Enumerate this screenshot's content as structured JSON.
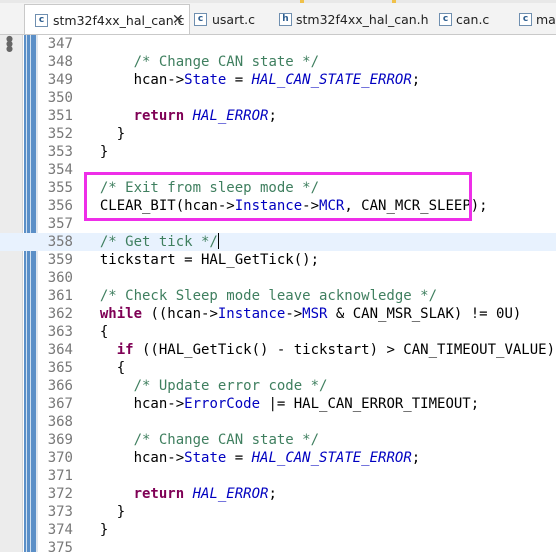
{
  "tabs": [
    {
      "label": "stm32f4xx_hal_can.c",
      "icon": "c-file-icon",
      "icon_letter": "c",
      "active": true,
      "close": "✕"
    },
    {
      "label": "usart.c",
      "icon": "c-file-icon",
      "icon_letter": "c",
      "active": false
    },
    {
      "label": "stm32f4xx_hal_can.h",
      "icon": "h-file-icon",
      "icon_letter": "h",
      "active": false
    },
    {
      "label": "can.c",
      "icon": "c-file-icon",
      "icon_letter": "c",
      "active": false
    },
    {
      "label": "main",
      "icon": "c-file-icon",
      "icon_letter": "c",
      "active": false
    }
  ],
  "editor": {
    "current_line": 358,
    "highlighted_lines": [
      355,
      356
    ],
    "highlight_color": "#ee2ee8",
    "lines": [
      {
        "n": "347",
        "segs": []
      },
      {
        "n": "348",
        "segs": [
          {
            "t": "      "
          },
          {
            "t": "/* Change CAN state */",
            "s": "c"
          }
        ]
      },
      {
        "n": "349",
        "segs": [
          {
            "t": "      hcan->"
          },
          {
            "t": "State",
            "s": "f"
          },
          {
            "t": " = "
          },
          {
            "t": "HAL_CAN_STATE_ERROR",
            "s": "i"
          },
          {
            "t": ";"
          }
        ]
      },
      {
        "n": "350",
        "segs": []
      },
      {
        "n": "351",
        "segs": [
          {
            "t": "      "
          },
          {
            "t": "return",
            "s": "k"
          },
          {
            "t": " "
          },
          {
            "t": "HAL_ERROR",
            "s": "i"
          },
          {
            "t": ";"
          }
        ]
      },
      {
        "n": "352",
        "segs": [
          {
            "t": "    }"
          }
        ]
      },
      {
        "n": "353",
        "segs": [
          {
            "t": "  }"
          }
        ]
      },
      {
        "n": "354",
        "segs": []
      },
      {
        "n": "355",
        "segs": [
          {
            "t": "  "
          },
          {
            "t": "/* Exit from sleep mode */",
            "s": "c"
          }
        ]
      },
      {
        "n": "356",
        "segs": [
          {
            "t": "  CLEAR_BIT(hcan->"
          },
          {
            "t": "Instance",
            "s": "f"
          },
          {
            "t": "->"
          },
          {
            "t": "MCR",
            "s": "f"
          },
          {
            "t": ", CAN_MCR_SLEEP);"
          }
        ]
      },
      {
        "n": "357",
        "segs": []
      },
      {
        "n": "358",
        "segs": [
          {
            "t": "  "
          },
          {
            "t": "/* Get tick */",
            "s": "c"
          }
        ]
      },
      {
        "n": "359",
        "segs": [
          {
            "t": "  tickstart = HAL_GetTick();"
          }
        ]
      },
      {
        "n": "360",
        "segs": []
      },
      {
        "n": "361",
        "segs": [
          {
            "t": "  "
          },
          {
            "t": "/* Check Sleep mode leave acknowledge */",
            "s": "c"
          }
        ]
      },
      {
        "n": "362",
        "segs": [
          {
            "t": "  "
          },
          {
            "t": "while",
            "s": "k"
          },
          {
            "t": " ((hcan->"
          },
          {
            "t": "Instance",
            "s": "f"
          },
          {
            "t": "->"
          },
          {
            "t": "MSR",
            "s": "f"
          },
          {
            "t": " & CAN_MSR_SLAK) != 0U)"
          }
        ]
      },
      {
        "n": "363",
        "segs": [
          {
            "t": "  {"
          }
        ]
      },
      {
        "n": "364",
        "segs": [
          {
            "t": "    "
          },
          {
            "t": "if",
            "s": "k"
          },
          {
            "t": " ((HAL_GetTick() - tickstart) > CAN_TIMEOUT_VALUE)"
          }
        ]
      },
      {
        "n": "365",
        "segs": [
          {
            "t": "    {"
          }
        ]
      },
      {
        "n": "366",
        "segs": [
          {
            "t": "      "
          },
          {
            "t": "/* Update error code */",
            "s": "c"
          }
        ]
      },
      {
        "n": "367",
        "segs": [
          {
            "t": "      hcan->"
          },
          {
            "t": "ErrorCode",
            "s": "f"
          },
          {
            "t": " |= HAL_CAN_ERROR_TIMEOUT;"
          }
        ]
      },
      {
        "n": "368",
        "segs": []
      },
      {
        "n": "369",
        "segs": [
          {
            "t": "      "
          },
          {
            "t": "/* Change CAN state */",
            "s": "c"
          }
        ]
      },
      {
        "n": "370",
        "segs": [
          {
            "t": "      hcan->"
          },
          {
            "t": "State",
            "s": "f"
          },
          {
            "t": " = "
          },
          {
            "t": "HAL_CAN_STATE_ERROR",
            "s": "i"
          },
          {
            "t": ";"
          }
        ]
      },
      {
        "n": "371",
        "segs": []
      },
      {
        "n": "372",
        "segs": [
          {
            "t": "      "
          },
          {
            "t": "return",
            "s": "k"
          },
          {
            "t": " "
          },
          {
            "t": "HAL_ERROR",
            "s": "i"
          },
          {
            "t": ";"
          }
        ]
      },
      {
        "n": "373",
        "segs": [
          {
            "t": "    }"
          }
        ]
      },
      {
        "n": "374",
        "segs": [
          {
            "t": "  }"
          }
        ]
      },
      {
        "n": "375",
        "segs": []
      }
    ]
  }
}
